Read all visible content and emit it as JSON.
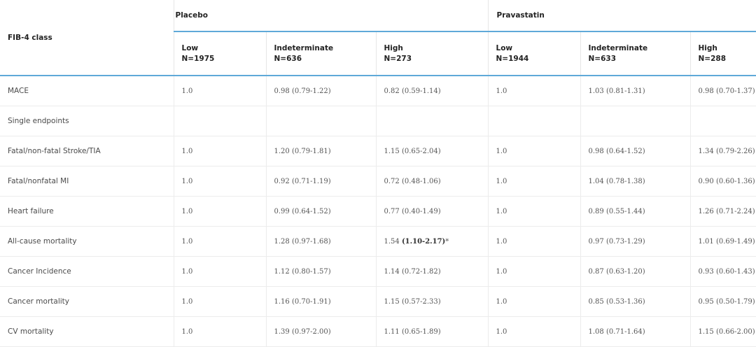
{
  "header": {
    "row_label_header": "FIB-4 class",
    "groups": [
      "Placebo",
      "Pravastatin"
    ],
    "subcolumns": [
      {
        "label": "Low",
        "n": "N=1975"
      },
      {
        "label": "Indeterminate",
        "n": "N=636"
      },
      {
        "label": "High",
        "n": "N=273"
      },
      {
        "label": "Low",
        "n": "N=1944"
      },
      {
        "label": "Indeterminate",
        "n": "N=633"
      },
      {
        "label": "High",
        "n": "N=288"
      }
    ]
  },
  "rows": [
    {
      "label": "MACE",
      "cells": [
        "1.0",
        "0.98 (0.79-1.22)",
        "0.82 (0.59-1.14)",
        "1.0",
        "1.03 (0.81-1.31)",
        "0.98 (0.70-1.37)"
      ]
    },
    {
      "label": "Single endpoints",
      "cells": [
        "",
        "",
        "",
        "",
        "",
        ""
      ]
    },
    {
      "label": "Fatal/non-fatal Stroke/TIA",
      "cells": [
        "1.0",
        "1.20 (0.79-1.81)",
        "1.15 (0.65-2.04)",
        "1.0",
        "0.98 (0.64-1.52)",
        "1.34 (0.79-2.26)"
      ]
    },
    {
      "label": "Fatal/nonfatal MI",
      "cells": [
        "1.0",
        "0.92 (0.71-1.19)",
        "0.72 (0.48-1.06)",
        "1.0",
        "1.04 (0.78-1.38)",
        "0.90 (0.60-1.36)"
      ]
    },
    {
      "label": "Heart failure",
      "cells": [
        "1.0",
        "0.99 (0.64-1.52)",
        "0.77 (0.40-1.49)",
        "1.0",
        "0.89 (0.55-1.44)",
        "1.26 (0.71-2.24)"
      ]
    },
    {
      "label": "All-cause mortality",
      "cells": [
        "1.0",
        "1.28 (0.97-1.68)",
        "",
        "1.0",
        "0.97 (0.73-1.29)",
        "1.01 (0.69-1.49)"
      ],
      "highlight": {
        "col": 2,
        "value": "1.54 ",
        "bold": "(1.10-2.17)",
        "suffix": "*"
      }
    },
    {
      "label": "Cancer Incidence",
      "cells": [
        "1.0",
        "1.12 (0.80-1.57)",
        "1.14 (0.72-1.82)",
        "1.0",
        "0.87 (0.63-1.20)",
        "0.93 (0.60-1.43)"
      ]
    },
    {
      "label": "Cancer mortality",
      "cells": [
        "1.0",
        "1.16 (0.70-1.91)",
        "1.15 (0.57-2.33)",
        "1.0",
        "0.85 (0.53-1.36)",
        "0.95 (0.50-1.79)"
      ]
    },
    {
      "label": "CV mortality",
      "cells": [
        "1.0",
        "1.39 (0.97-2.00)",
        "1.11 (0.65-1.89)",
        "1.0",
        "1.08 (0.71-1.64)",
        "1.15 (0.66-2.00)"
      ]
    }
  ]
}
